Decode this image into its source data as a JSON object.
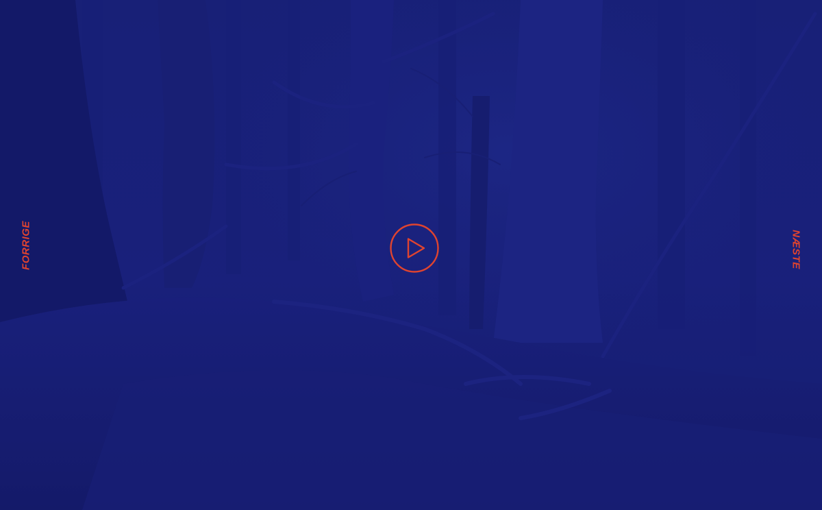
{
  "navigation": {
    "prev_label": "FORRIGE",
    "next_label": "NÆSTE"
  },
  "player": {
    "play_icon": "play-icon"
  },
  "colors": {
    "accent": "#e0442f",
    "overlay": "#18217a",
    "background_dark": "#0f1660"
  }
}
